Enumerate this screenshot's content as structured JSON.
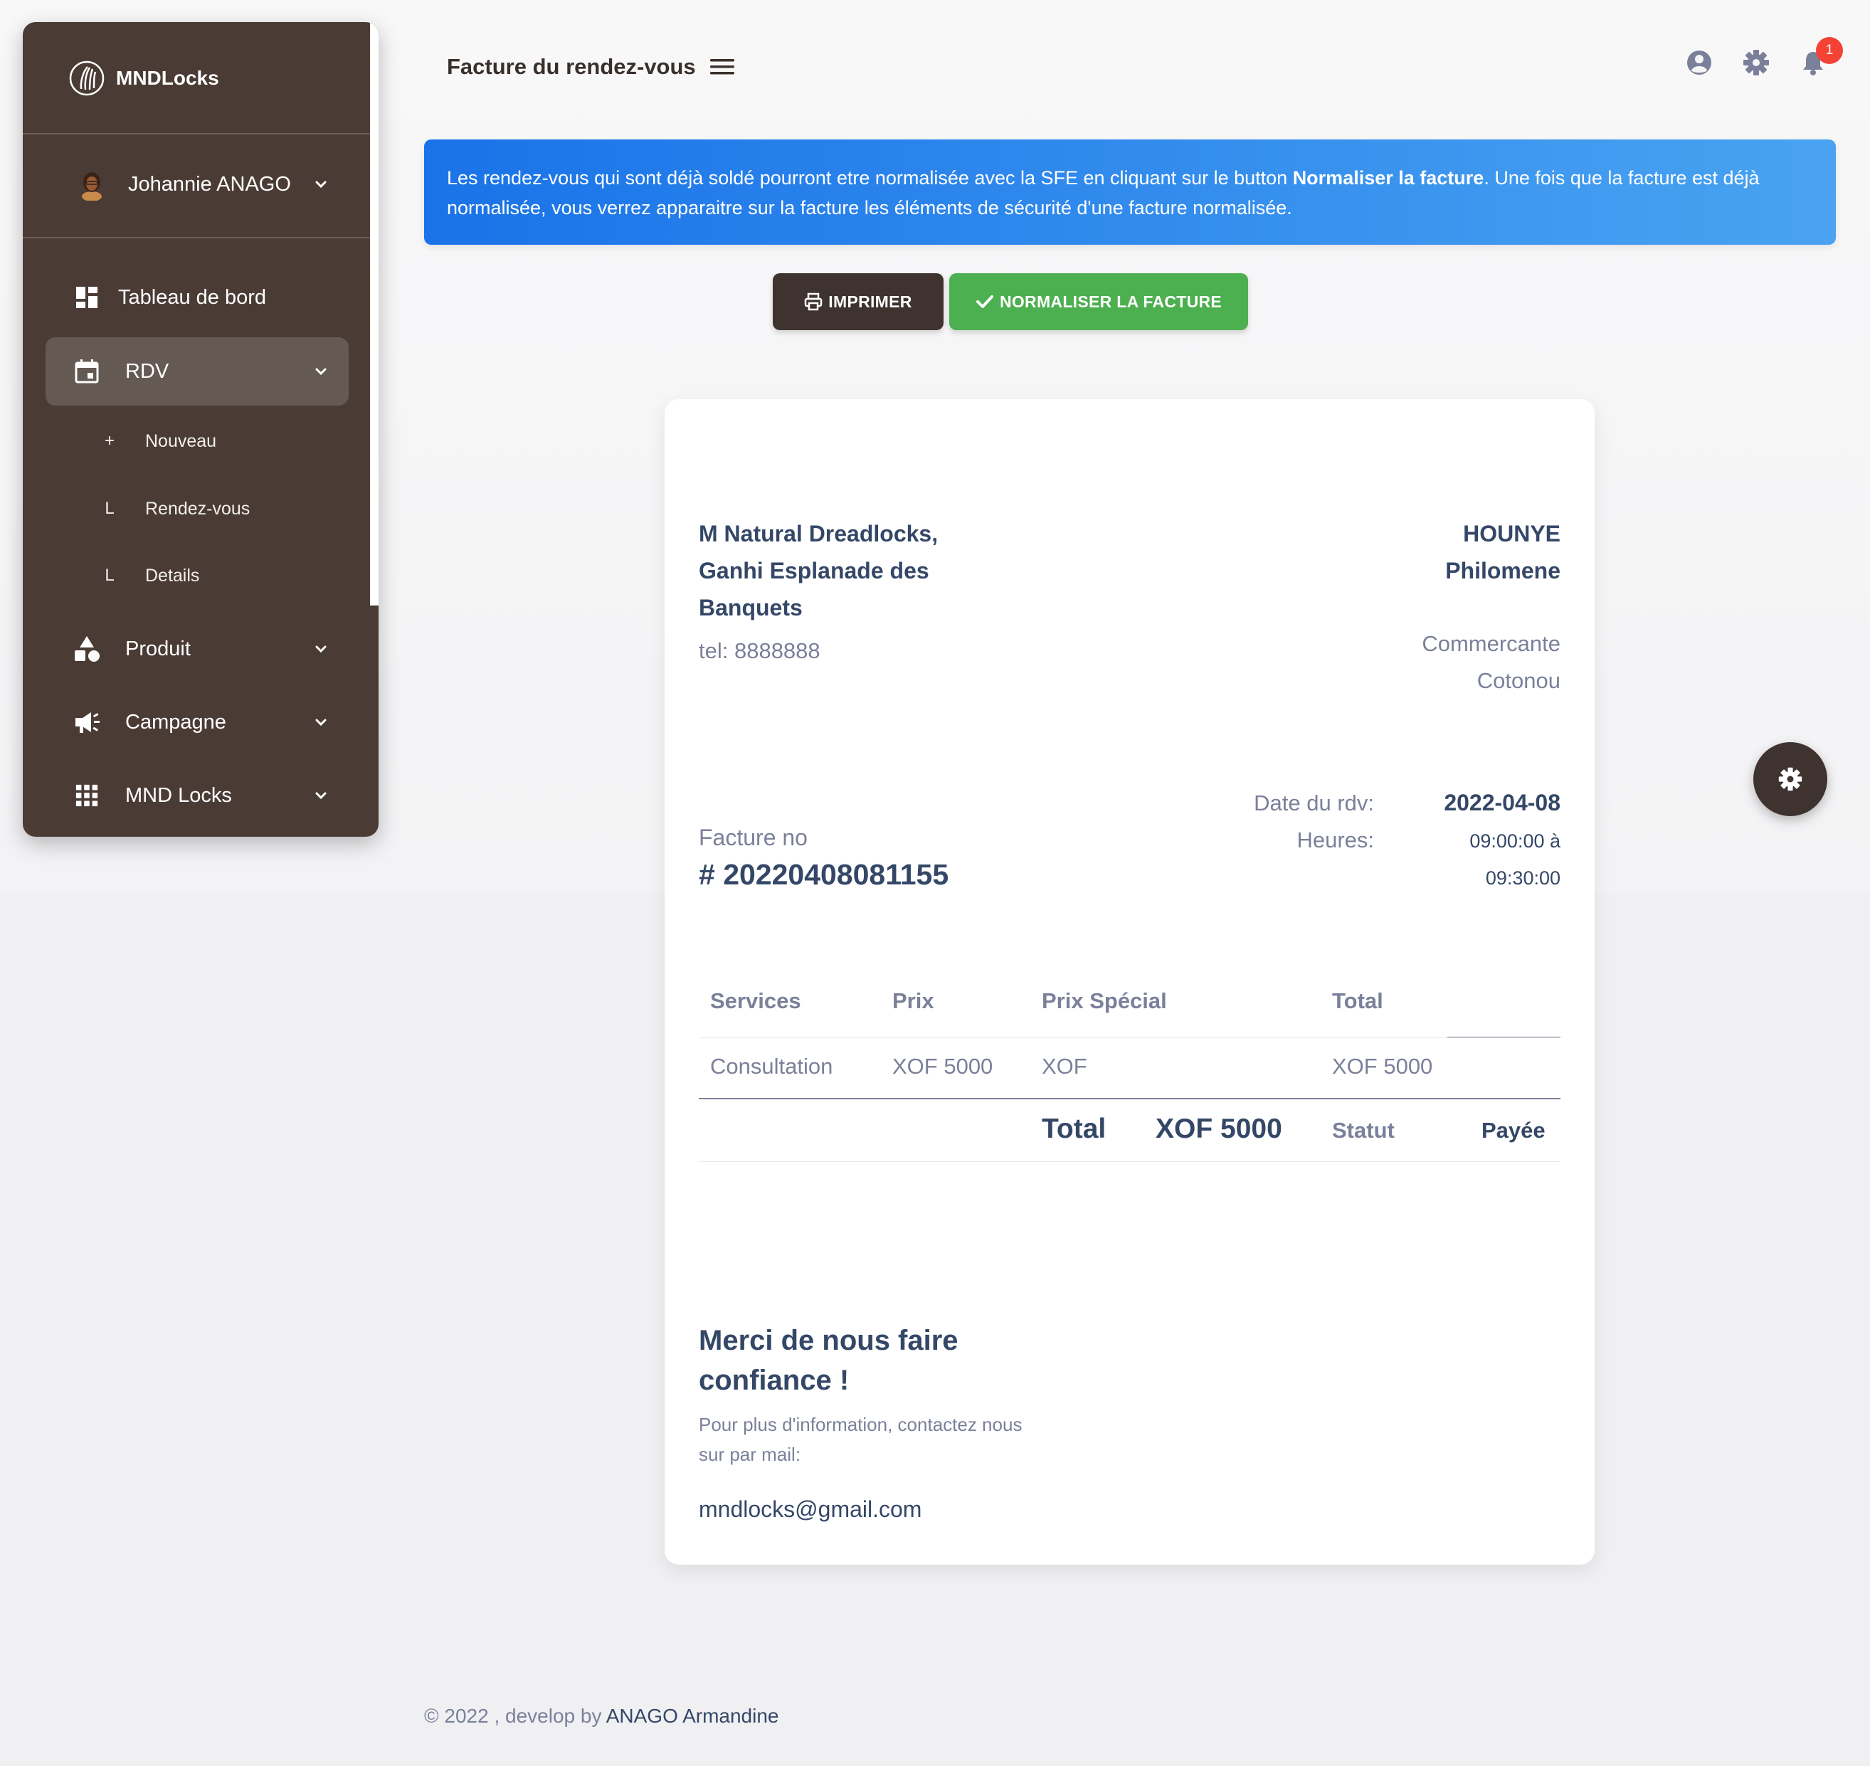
{
  "sidebar": {
    "brand": "MNDLocks",
    "user": "Johannie ANAGO",
    "items": [
      {
        "label": "Tableau de bord",
        "icon": "dashboard-icon"
      },
      {
        "label": "RDV",
        "icon": "calendar-icon"
      },
      {
        "label": "Produit",
        "icon": "shapes-icon"
      },
      {
        "label": "Campagne",
        "icon": "megaphone-icon"
      },
      {
        "label": "MND Locks",
        "icon": "apps-grid-icon"
      }
    ],
    "rdv_sub": [
      {
        "bullet": "+",
        "label": "Nouveau"
      },
      {
        "bullet": "L",
        "label": "Rendez-vous"
      },
      {
        "bullet": "L",
        "label": "Details"
      }
    ]
  },
  "navbar": {
    "title": "Facture du rendez-vous",
    "notification_count": "1"
  },
  "alert": {
    "text_before": "Les rendez-vous qui sont déjà soldé pourront etre normalisée avec la SFE en cliquant sur le button ",
    "bold": "Normaliser la facture",
    "text_after": ". Une fois que la facture est déjà normalisée, vous verrez apparaitre sur la facture les éléments de sécurité d'une facture normalisée."
  },
  "buttons": {
    "print": "IMPRIMER",
    "normalize": "NORMALISER LA FACTURE"
  },
  "invoice": {
    "company_lines": [
      "M Natural Dreadlocks,",
      "Ganhi Esplanade des",
      "Banquets"
    ],
    "tel": "tel: 8888888",
    "client_lines": [
      "HOUNYE",
      "Philomene"
    ],
    "client_job": "Commercante",
    "client_city": "Cotonou",
    "facture_label": "Facture no",
    "facture_number": "# 20220408081155",
    "date_label": "Date du rdv:",
    "date_value": "2022-04-08",
    "hours_label": "Heures:",
    "hours_start": "09:00:00 à",
    "hours_end": "09:30:00",
    "table": {
      "headers": [
        "Services",
        "Prix",
        "Prix Spécial",
        "Total"
      ],
      "rows": [
        [
          "Consultation",
          "XOF 5000",
          "XOF",
          "XOF 5000"
        ]
      ],
      "total_label": "Total",
      "total_value": "XOF 5000",
      "status_label": "Statut",
      "status_value": "Payée"
    },
    "thanks": "Merci de nous faire confiance !",
    "more_info": "Pour plus d'information, contactez nous sur par mail:",
    "email": "mndlocks@gmail.com"
  },
  "footer": {
    "prefix": "© 2022 , develop by ",
    "author": "ANAGO Armandine"
  },
  "colors": {
    "sidebar_bg": "#4a3c35",
    "alert_gradient_start": "#1A73E8",
    "alert_gradient_end": "#49a3f1",
    "success": "#4caf50",
    "dark_button": "#3f3330",
    "badge": "#f44335"
  }
}
